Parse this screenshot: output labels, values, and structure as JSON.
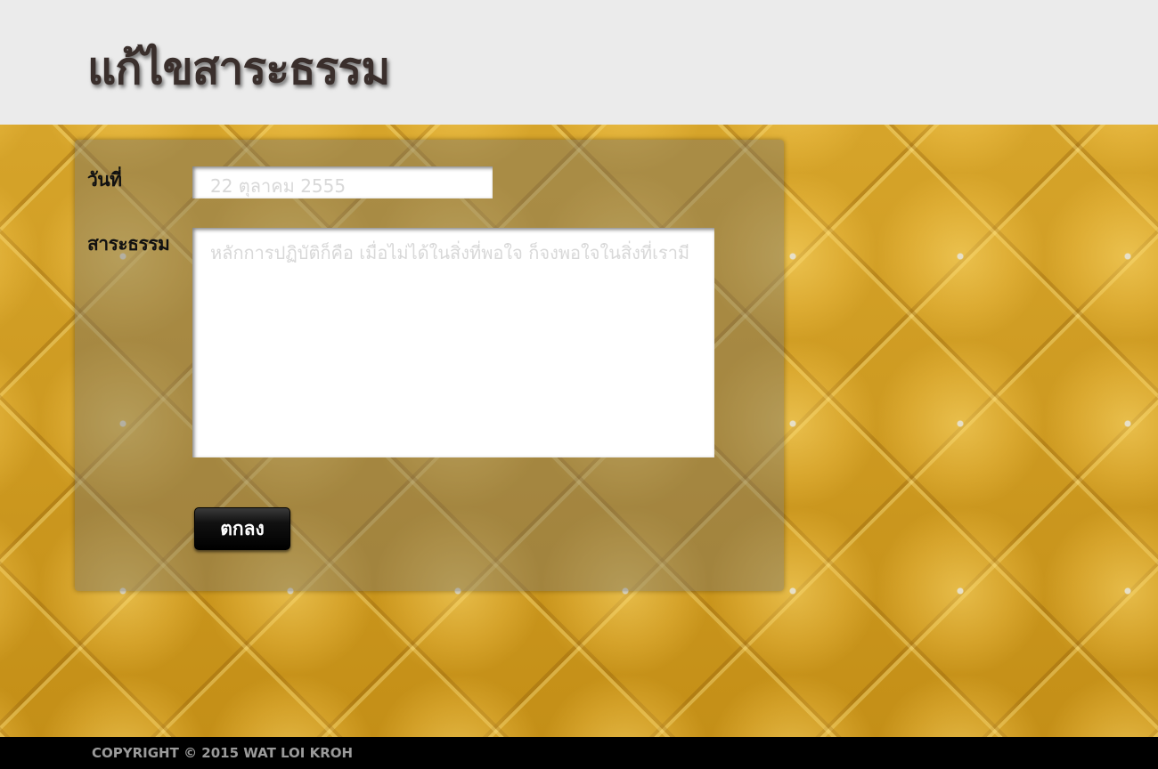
{
  "header": {
    "title": "แก้ไขสาระธรรม"
  },
  "form": {
    "date_label": "วันที่",
    "date_placeholder": "22 ตุลาคม 2555",
    "content_label": "สาระธรรม",
    "content_placeholder": "หลักการปฏิบัติก็คือ เมื่อไม่ได้ในสิ่งที่พอใจ ก็จงพอใจในสิ่งที่เรามี",
    "submit_label": "ตกลง"
  },
  "footer": {
    "copyright": "COPYRIGHT © 2015 WAT LOI KROH"
  },
  "colors": {
    "header_bg": "#ebebeb",
    "background_gold": "#c9961f",
    "footer_bg": "#000000",
    "button_bg": "#000000"
  }
}
